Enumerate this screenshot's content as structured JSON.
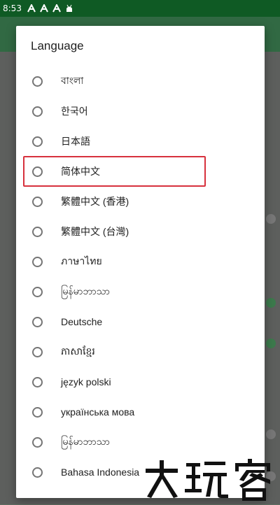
{
  "status_bar": {
    "time": "8:53",
    "icons": [
      "notification-a-icon",
      "notification-a-icon",
      "notification-a-icon",
      "android-icon"
    ]
  },
  "dialog": {
    "title": "Language",
    "options": [
      {
        "label": "বাংলা"
      },
      {
        "label": "한국어"
      },
      {
        "label": "日本語"
      },
      {
        "label": "简体中文"
      },
      {
        "label": "繁體中文 (香港)"
      },
      {
        "label": "繁體中文 (台灣)"
      },
      {
        "label": "ภาษาไทย"
      },
      {
        "label": "မြန်မာဘာသာ"
      },
      {
        "label": "Deutsche"
      },
      {
        "label": "ភាសាខ្មែរ"
      },
      {
        "label": "język polski"
      },
      {
        "label": "українська мова"
      },
      {
        "label": "မြန်မာဘာသာ"
      },
      {
        "label": "Bahasa Indonesia"
      }
    ],
    "selected_index": -1,
    "highlighted_index": 3
  },
  "watermark": "大玩客",
  "colors": {
    "status_bar": "#0f5a24",
    "highlight_box": "#d7313d",
    "radio": "#757575"
  }
}
